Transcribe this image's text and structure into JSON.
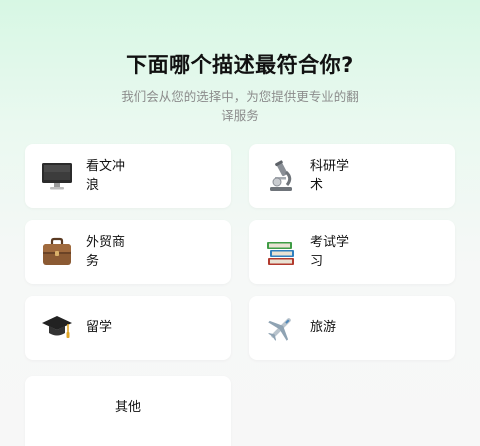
{
  "title": "下面哪个描述最符合你?",
  "subtitle": "我们会从您的选择中，为您提供更专业的翻译服务",
  "options": [
    {
      "label": "看文冲浪",
      "icon": "monitor-icon"
    },
    {
      "label": "科研学术",
      "icon": "microscope-icon"
    },
    {
      "label": "外贸商务",
      "icon": "briefcase-icon"
    },
    {
      "label": "考试学习",
      "icon": "books-icon"
    },
    {
      "label": "留学",
      "icon": "graduation-cap-icon"
    },
    {
      "label": "旅游",
      "icon": "airplane-icon"
    },
    {
      "label": "其他",
      "icon": ""
    }
  ]
}
